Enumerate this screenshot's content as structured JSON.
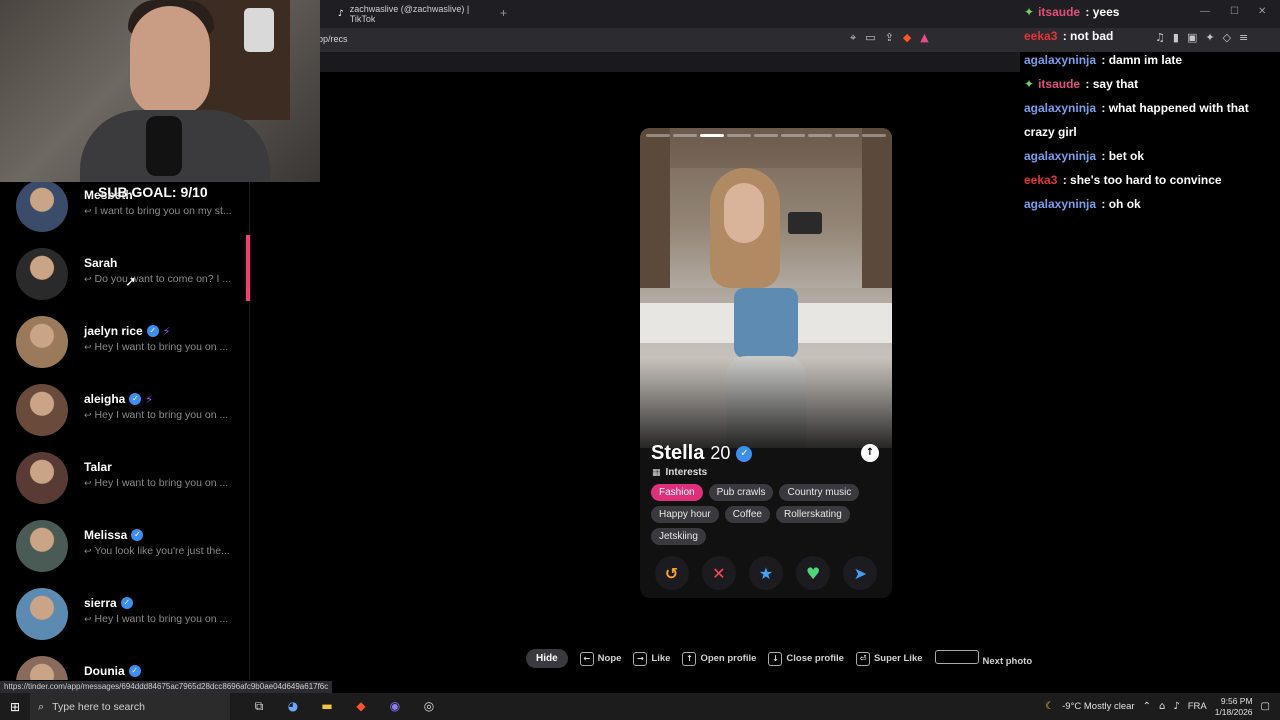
{
  "browser": {
    "tab_title": "zachwaslive (@zachwaslive) | TikTok",
    "tab_icon": "tiktok-icon",
    "new_tab": "+",
    "url": "pp/recs",
    "status_url": "https://tinder.com/app/messages/694ddd84675ac7965d28dcc8696afc9b0ae04d649a617f6c"
  },
  "overlay": {
    "sub_goal": "SUB GOAL: 9/10"
  },
  "matches": [
    {
      "name": "Mesbeth",
      "verified": false,
      "boosted": false,
      "message": "I want to bring you on my st..."
    },
    {
      "name": "Sarah",
      "verified": false,
      "boosted": false,
      "message": "Do you want to come on? I ..."
    },
    {
      "name": "jaelyn rice",
      "verified": true,
      "boosted": true,
      "message": "Hey I want to bring you on ..."
    },
    {
      "name": "aleigha",
      "verified": true,
      "boosted": true,
      "message": "Hey I want to bring you on ..."
    },
    {
      "name": "Talar",
      "verified": false,
      "boosted": false,
      "message": "Hey I want to bring you on ..."
    },
    {
      "name": "Melissa",
      "verified": true,
      "boosted": false,
      "message": "You look like you're just the..."
    },
    {
      "name": "sierra",
      "verified": true,
      "boosted": false,
      "message": "Hey I want to bring you on ..."
    },
    {
      "name": "Dounia",
      "verified": true,
      "boosted": false,
      "message": ""
    }
  ],
  "profile": {
    "name": "Stella",
    "age": "20",
    "interests_title": "Interests",
    "interests": [
      {
        "label": "Fashion",
        "highlight": true
      },
      {
        "label": "Pub crawls",
        "highlight": false
      },
      {
        "label": "Country music",
        "highlight": false
      },
      {
        "label": "Happy hour",
        "highlight": false
      },
      {
        "label": "Coffee",
        "highlight": false
      },
      {
        "label": "Rollerskating",
        "highlight": false
      },
      {
        "label": "Jetskiing",
        "highlight": false
      }
    ],
    "photo_count": 9,
    "active_photo": 2,
    "actions": [
      {
        "name": "rewind-button",
        "icon": "↺",
        "color": "#f6a623"
      },
      {
        "name": "nope-button",
        "icon": "✕",
        "color": "#ff4458"
      },
      {
        "name": "super-like-button",
        "icon": "★",
        "color": "#36a6ff"
      },
      {
        "name": "like-button",
        "icon": "♥",
        "color": "#4ed87a"
      },
      {
        "name": "boost-button",
        "icon": "➤",
        "color": "#3aa0ff"
      }
    ]
  },
  "shortcuts": {
    "hide": "Hide",
    "items": [
      {
        "key": "←",
        "label": "Nope"
      },
      {
        "key": "→",
        "label": "Like"
      },
      {
        "key": "↑",
        "label": "Open profile"
      },
      {
        "key": "↓",
        "label": "Close profile"
      },
      {
        "key": "⏎",
        "label": "Super Like"
      },
      {
        "key": "",
        "label": "Next photo"
      }
    ]
  },
  "chat": [
    {
      "user": "itsaude",
      "color": "#e0507a",
      "gem": true,
      "text": "yees"
    },
    {
      "user": "eeka3",
      "color": "#e3343b",
      "gem": false,
      "text": "not bad"
    },
    {
      "user": "agalaxyninja",
      "color": "#7a9ee8",
      "gem": false,
      "text": "damn im late"
    },
    {
      "user": "itsaude",
      "color": "#e0507a",
      "gem": true,
      "text": "say that"
    },
    {
      "user": "agalaxyninja",
      "color": "#7a9ee8",
      "gem": false,
      "text": "what happened with that crazy girl"
    },
    {
      "user": "agalaxyninja",
      "color": "#7a9ee8",
      "gem": false,
      "text": "bet ok"
    },
    {
      "user": "eeka3",
      "color": "#e3343b",
      "gem": false,
      "text": "she's too hard to convince"
    },
    {
      "user": "agalaxyninja",
      "color": "#7a9ee8",
      "gem": false,
      "text": "oh ok"
    }
  ],
  "taskbar": {
    "search_placeholder": "Type here to search",
    "weather": "-9°C  Mostly clear",
    "lang": "FRA",
    "time": "9:56 PM",
    "date": "1/18/2026"
  }
}
